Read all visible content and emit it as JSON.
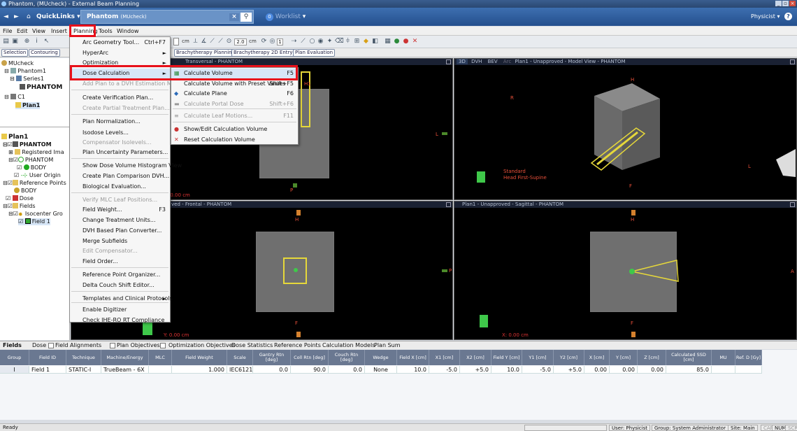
{
  "window": {
    "title": "Phantom, (MUcheck) - External Beam Planning"
  },
  "nav": {
    "quicklinks": "QuickLinks",
    "tab_title": "Phantom",
    "tab_sub": "(MUcheck)",
    "worklist_count": "0",
    "worklist": "Worklist",
    "user": "Physicist"
  },
  "menubar": [
    "File",
    "Edit",
    "View",
    "Insert",
    "Planning",
    "Tools",
    "Window"
  ],
  "toolbar": {
    "field1": "2.0",
    "unit1": "cm",
    "unit2": "cm",
    "field2": "1"
  },
  "workspaces": [
    "Selection",
    "Contouring",
    "Brachytherapy Planning",
    "Brachytherapy 2D Entry",
    "Plan Evaluation"
  ],
  "tree_top": {
    "root": "MUcheck",
    "phantom": "Phantom1",
    "series": "Series1",
    "image": "PHANTOM",
    "course": "C1",
    "plan": "Plan1"
  },
  "tree_bottom": {
    "plan": "Plan1",
    "image": "PHANTOM",
    "registered": "Registered Ima",
    "structure_set": "PHANTOM",
    "body": "BODY",
    "user_origin": "User Origin",
    "ref_points": "Reference Points",
    "ref_body": "BODY",
    "dose": "Dose",
    "fields": "Fields",
    "isocenter": "Isocenter Gro",
    "field": "Field 1"
  },
  "planning_menu": [
    {
      "label": "Arc Geometry Tool...",
      "shortcut": "Ctrl+F7",
      "enabled": true
    },
    {
      "label": "HyperArc",
      "arrow": "►",
      "enabled": true
    },
    {
      "label": "Optimization",
      "arrow": "►",
      "enabled": true
    },
    {
      "label": "Dose Calculation",
      "arrow": "►",
      "enabled": true
    },
    {
      "label": "Add Plan to a DVH Estimation Model",
      "enabled": false
    },
    {
      "label": "Create Verification Plan...",
      "enabled": true
    },
    {
      "label": "Create Partial Treatment Plan...",
      "enabled": false
    },
    {
      "label": "Plan Normalization...",
      "enabled": true
    },
    {
      "label": "Isodose Levels...",
      "enabled": true
    },
    {
      "label": "Compensator Isolevels...",
      "enabled": false
    },
    {
      "label": "Plan Uncertainty Parameters...",
      "enabled": true
    },
    {
      "label": "Show Dose Volume Histogram View",
      "enabled": true
    },
    {
      "label": "Create Plan Comparison DVH...",
      "enabled": true
    },
    {
      "label": "Biological Evaluation...",
      "enabled": true
    },
    {
      "label": "Verify MLC Leaf Positions...",
      "enabled": false
    },
    {
      "label": "Field Weight...",
      "shortcut": "F3",
      "enabled": true
    },
    {
      "label": "Change Treatment Units...",
      "enabled": true
    },
    {
      "label": "DVH Based Plan Converter...",
      "enabled": true
    },
    {
      "label": "Merge Subfields",
      "enabled": true
    },
    {
      "label": "Edit Compensator...",
      "enabled": false
    },
    {
      "label": "Field Order...",
      "enabled": true
    },
    {
      "label": "Reference Point Organizer...",
      "enabled": true
    },
    {
      "label": "Delta Couch Shift Editor...",
      "enabled": true
    },
    {
      "label": "Templates and Clinical Protocols",
      "arrow": "►",
      "enabled": true
    },
    {
      "label": "Enable Digitizer",
      "enabled": true
    },
    {
      "label": "Check IHE-RO RT Compliance",
      "enabled": true
    }
  ],
  "dose_submenu": [
    {
      "label": "Calculate Volume",
      "shortcut": "F5",
      "enabled": true
    },
    {
      "label": "Calculate Volume with Preset Values",
      "shortcut": "Shift+F5",
      "enabled": true
    },
    {
      "label": "Calculate Plane",
      "shortcut": "F6",
      "enabled": true
    },
    {
      "label": "Calculate Portal Dose",
      "shortcut": "Shift+F6",
      "enabled": false
    },
    {
      "label": "Calculate Leaf Motions...",
      "shortcut": "F11",
      "enabled": false
    },
    {
      "label": "Show/Edit Calculation Volume",
      "enabled": true
    },
    {
      "label": "Reset Calculation Volume",
      "enabled": true
    }
  ],
  "viewports": {
    "transversal_title": "Transversal - PHANTOM",
    "model_tabs": [
      "3D",
      "DVH",
      "BEV",
      "Arc"
    ],
    "model_title": "Plan1 - Unapproved - Model View - PHANTOM",
    "frontal_title": "ved - Frontal - PHANTOM",
    "sagittal_title": "Plan1 - Unapproved - Sagittal - PHANTOM",
    "trans_coord": "Z: 0.00 cm",
    "front_coord": "Y: 0.00 cm",
    "sag_coord": "X: 0.00 cm",
    "orient_text1": "Standard",
    "orient_text2": "Head First-Supine",
    "labels": {
      "H": "H",
      "F": "F",
      "L": "L",
      "R": "R",
      "P": "P",
      "A": "A"
    }
  },
  "bottom_tabs": [
    "Fields",
    "Dose",
    "Field Alignments",
    "Plan Objectives",
    "Optimization Objectives",
    "Dose Statistics",
    "Reference Points",
    "Calculation Models",
    "Plan Sum"
  ],
  "grid": {
    "headers": [
      "Group",
      "Field ID",
      "Technique",
      "Machine/Energy",
      "MLC",
      "Field Weight",
      "Scale",
      "Gantry Rtn [deg]",
      "Coll Rtn [deg]",
      "Couch Rtn [deg]",
      "Wedge",
      "Field X [cm]",
      "X1 [cm]",
      "X2 [cm]",
      "Field Y [cm]",
      "Y1 [cm]",
      "Y2 [cm]",
      "X [cm]",
      "Y [cm]",
      "Z [cm]",
      "Calculated SSD [cm]",
      "MU",
      "Ref. D [Gy]"
    ],
    "row": [
      "I",
      "Field 1",
      "STATIC-I",
      "TrueBeam - 6X",
      "",
      "1.000",
      "IEC61217",
      "0.0",
      "90.0",
      "0.0",
      "None",
      "10.0",
      "-5.0",
      "+5.0",
      "10.0",
      "-5.0",
      "+5.0",
      "0.00",
      "0.00",
      "0.00",
      "85.0",
      "",
      ""
    ]
  },
  "status": {
    "left": "Ready",
    "user": "User: Physicist",
    "group": "Group: System Administrator",
    "site": "Site: Main",
    "caps": "CAP",
    "num": "NUM",
    "scrl": "SCR"
  }
}
